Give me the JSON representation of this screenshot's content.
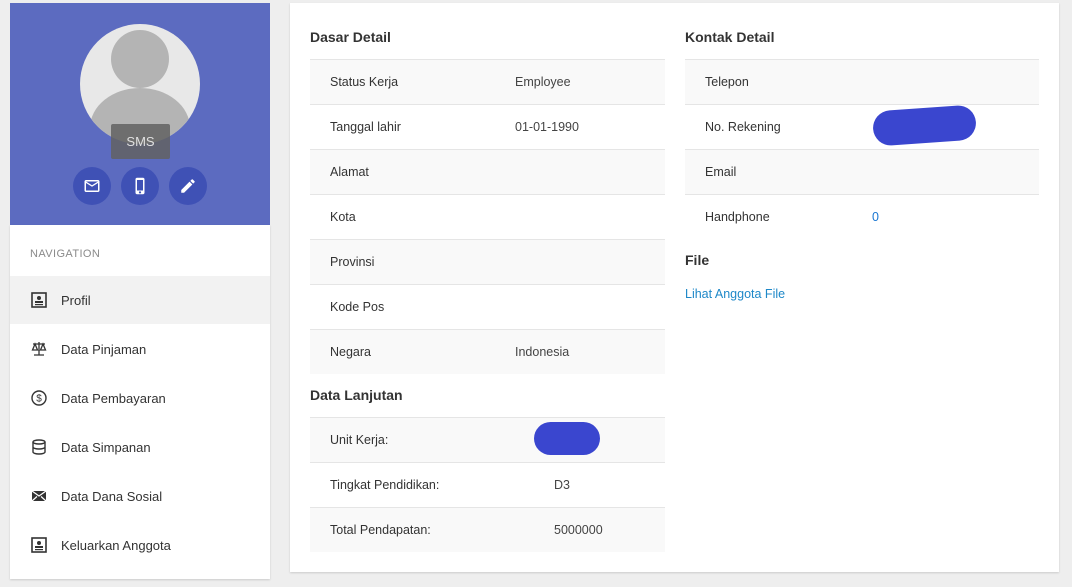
{
  "profile": {
    "sms_tooltip": "SMS",
    "actions": [
      {
        "icon": "mail-icon"
      },
      {
        "icon": "mobile-icon"
      },
      {
        "icon": "pencil-icon"
      }
    ],
    "header_color": "#5c6bc0",
    "button_color": "#3f51b5"
  },
  "navigation": {
    "heading": "NAVIGATION",
    "items": [
      {
        "label": "Profil",
        "icon": "profile-card-icon",
        "active": true
      },
      {
        "label": "Data Pinjaman",
        "icon": "scale-icon"
      },
      {
        "label": "Data Pembayaran",
        "icon": "dollar-icon"
      },
      {
        "label": "Data Simpanan",
        "icon": "database-icon"
      },
      {
        "label": "Data Dana Sosial",
        "icon": "envelope-icon"
      },
      {
        "label": "Keluarkan Anggota",
        "icon": "profile-card-icon"
      }
    ]
  },
  "dasar_detail": {
    "title": "Dasar Detail",
    "rows": [
      {
        "label": "Status Kerja",
        "value": "Employee"
      },
      {
        "label": "Tanggal lahir",
        "value": "01-01-1990"
      },
      {
        "label": "Alamat",
        "value": ""
      },
      {
        "label": "Kota",
        "value": ""
      },
      {
        "label": "Provinsi",
        "value": ""
      },
      {
        "label": "Kode Pos",
        "value": ""
      },
      {
        "label": "Negara",
        "value": "Indonesia"
      }
    ]
  },
  "data_lanjutan": {
    "title": "Data Lanjutan",
    "rows": [
      {
        "label": "Unit Kerja:",
        "value": ""
      },
      {
        "label": "Tingkat Pendidikan:",
        "value": "D3"
      },
      {
        "label": "Total Pendapatan:",
        "value": "5000000"
      }
    ]
  },
  "kontak_detail": {
    "title": "Kontak Detail",
    "rows": [
      {
        "label": "Telepon",
        "value": ""
      },
      {
        "label": "No. Rekening",
        "value": ""
      },
      {
        "label": "Email",
        "value": ""
      },
      {
        "label": "Handphone",
        "value": "0"
      }
    ]
  },
  "file": {
    "title": "File",
    "link": "Lihat Anggota File"
  }
}
